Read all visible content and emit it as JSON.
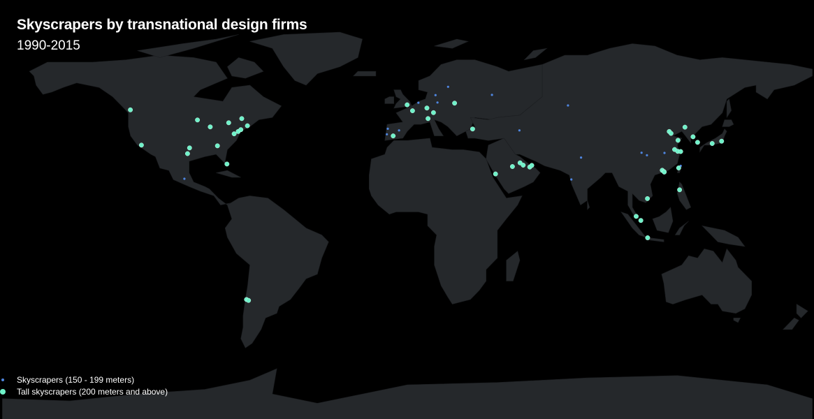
{
  "title": "Skyscrapers by transnational design firms",
  "subtitle": "1990-2015",
  "colors": {
    "background": "#000000",
    "land": "#25282b",
    "small_marker": "#4f86e0",
    "tall_marker": "#6ff2c9"
  },
  "legend": {
    "items": [
      {
        "label": "Skyscrapers (150 - 199 meters)",
        "marker": "small",
        "color": "#4f86e0"
      },
      {
        "label": "Tall skyscrapers (200 meters and above)",
        "marker": "tall",
        "color": "#6ff2c9"
      }
    ]
  },
  "chart_data": {
    "type": "scatter",
    "projection": "equirectangular",
    "lon_range": [
      -180,
      180
    ],
    "lat_range": [
      -90,
      90
    ],
    "series": [
      {
        "name": "Skyscrapers (150 - 199 meters)",
        "points": [
          {
            "lon": -118.3,
            "lat": 34.1
          },
          {
            "lon": -74.0,
            "lat": 40.7
          },
          {
            "lon": -99.1,
            "lat": 19.4
          },
          {
            "lon": -9.1,
            "lat": 38.7
          },
          {
            "lon": -3.7,
            "lat": 40.4
          },
          {
            "lon": -8.7,
            "lat": 41.1
          },
          {
            "lon": 2.3,
            "lat": 48.9
          },
          {
            "lon": 4.9,
            "lat": 52.4
          },
          {
            "lon": 12.5,
            "lat": 55.7
          },
          {
            "lon": 13.4,
            "lat": 52.5
          },
          {
            "lon": 18.1,
            "lat": 59.3
          },
          {
            "lon": 37.6,
            "lat": 55.8
          },
          {
            "lon": 49.8,
            "lat": 40.4
          },
          {
            "lon": 71.4,
            "lat": 51.2
          },
          {
            "lon": 72.9,
            "lat": 19.1
          },
          {
            "lon": 77.2,
            "lat": 28.6
          },
          {
            "lon": 104.1,
            "lat": 30.7
          },
          {
            "lon": 106.5,
            "lat": 29.6
          },
          {
            "lon": 114.3,
            "lat": 30.6
          },
          {
            "lon": 121.5,
            "lat": 25.0
          }
        ]
      },
      {
        "name": "Tall skyscrapers (200 meters and above)",
        "points": [
          {
            "lon": -123.1,
            "lat": 49.3
          },
          {
            "lon": -118.2,
            "lat": 34.0
          },
          {
            "lon": -97.7,
            "lat": 30.3
          },
          {
            "lon": -96.8,
            "lat": 32.8
          },
          {
            "lon": -87.6,
            "lat": 41.9
          },
          {
            "lon": -84.4,
            "lat": 33.7
          },
          {
            "lon": -80.2,
            "lat": 25.8
          },
          {
            "lon": -79.4,
            "lat": 43.7
          },
          {
            "lon": -77.0,
            "lat": 38.9
          },
          {
            "lon": -75.2,
            "lat": 39.9
          },
          {
            "lon": -71.1,
            "lat": 42.4
          },
          {
            "lon": -73.6,
            "lat": 45.5
          },
          {
            "lon": -93.3,
            "lat": 44.9
          },
          {
            "lon": -74.0,
            "lat": 40.7
          },
          {
            "lon": -71.5,
            "lat": -33.0
          },
          {
            "lon": -70.6,
            "lat": -33.4
          },
          {
            "lon": -0.1,
            "lat": 51.5
          },
          {
            "lon": 2.3,
            "lat": 48.9
          },
          {
            "lon": 8.7,
            "lat": 50.1
          },
          {
            "lon": 9.2,
            "lat": 45.5
          },
          {
            "lon": 11.6,
            "lat": 48.1
          },
          {
            "lon": 21.0,
            "lat": 52.2
          },
          {
            "lon": 29.0,
            "lat": 41.0
          },
          {
            "lon": -6.3,
            "lat": 38.0
          },
          {
            "lon": 46.7,
            "lat": 24.7
          },
          {
            "lon": 39.2,
            "lat": 21.5
          },
          {
            "lon": 50.1,
            "lat": 26.3
          },
          {
            "lon": 51.5,
            "lat": 25.3
          },
          {
            "lon": 54.4,
            "lat": 24.5
          },
          {
            "lon": 55.3,
            "lat": 25.2
          },
          {
            "lon": 116.4,
            "lat": 39.9
          },
          {
            "lon": 117.2,
            "lat": 39.1
          },
          {
            "lon": 118.8,
            "lat": 32.1
          },
          {
            "lon": 120.2,
            "lat": 31.3
          },
          {
            "lon": 121.5,
            "lat": 31.2
          },
          {
            "lon": 113.3,
            "lat": 23.1
          },
          {
            "lon": 114.1,
            "lat": 22.5
          },
          {
            "lon": 114.2,
            "lat": 22.3
          },
          {
            "lon": 120.3,
            "lat": 36.1
          },
          {
            "lon": 127.0,
            "lat": 37.6
          },
          {
            "lon": 129.0,
            "lat": 35.2
          },
          {
            "lon": 139.7,
            "lat": 35.7
          },
          {
            "lon": 135.5,
            "lat": 34.7
          },
          {
            "lon": 123.4,
            "lat": 41.8
          },
          {
            "lon": 106.7,
            "lat": 10.8
          },
          {
            "lon": 101.7,
            "lat": 3.1
          },
          {
            "lon": 103.8,
            "lat": 1.3
          },
          {
            "lon": 106.8,
            "lat": -6.2
          },
          {
            "lon": 121.0,
            "lat": 14.6
          },
          {
            "lon": 120.6,
            "lat": 24.1
          }
        ]
      }
    ]
  }
}
